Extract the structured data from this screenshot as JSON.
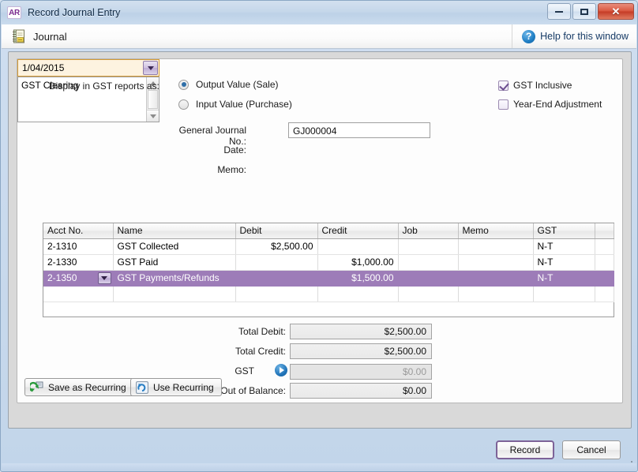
{
  "window": {
    "app_badge": "AR",
    "title": "Record Journal Entry",
    "controls": {
      "minimize": "minimize-icon",
      "maximize": "maximize-icon",
      "close": "✕"
    }
  },
  "header": {
    "icon": "journal-icon",
    "title": "Journal",
    "help_icon": "question-mark-icon",
    "help_label": "Help for this window"
  },
  "options": {
    "display_label": "Display in GST reports as:",
    "radios": [
      {
        "label": "Output Value (Sale)",
        "selected": true
      },
      {
        "label": "Input Value (Purchase)",
        "selected": false
      }
    ],
    "checkboxes": [
      {
        "label": "GST Inclusive",
        "checked": true
      },
      {
        "label": "Year-End Adjustment",
        "checked": false
      }
    ]
  },
  "form": {
    "journal_no_label": "General Journal No.:",
    "journal_no_value": "GJ000004",
    "date_label": "Date:",
    "date_value": "1/04/2015",
    "memo_label": "Memo:",
    "memo_value": "GST Clearing"
  },
  "grid": {
    "columns": [
      "Acct No.",
      "Name",
      "Debit",
      "Credit",
      "Job",
      "Memo",
      "GST"
    ],
    "rows": [
      {
        "acct": "2-1310",
        "name": "GST Collected",
        "debit": "$2,500.00",
        "credit": "",
        "job": "",
        "memo": "",
        "gst": "N-T",
        "selected": false
      },
      {
        "acct": "2-1330",
        "name": "GST Paid",
        "debit": "",
        "credit": "$1,000.00",
        "job": "",
        "memo": "",
        "gst": "N-T",
        "selected": false
      },
      {
        "acct": "2-1350",
        "name": "GST Payments/Refunds",
        "debit": "",
        "credit": "$1,500.00",
        "job": "",
        "memo": "",
        "gst": "N-T",
        "selected": true
      },
      {
        "acct": "",
        "name": "",
        "debit": "",
        "credit": "",
        "job": "",
        "memo": "",
        "gst": "",
        "selected": false
      }
    ]
  },
  "totals": {
    "total_debit_label": "Total Debit:",
    "total_debit_value": "$2,500.00",
    "total_credit_label": "Total Credit:",
    "total_credit_value": "$2,500.00",
    "gst_label": "GST",
    "gst_value": "$0.00",
    "gst_arrow_icon": "blue-arrow-right-icon",
    "out_of_balance_label": "Out of Balance:",
    "out_of_balance_value": "$0.00"
  },
  "actions": {
    "save_recurring_label": "Save as Recurring",
    "save_recurring_icon": "recurring-save-icon",
    "use_recurring_label": "Use Recurring",
    "use_recurring_icon": "recurring-refresh-icon",
    "record_label": "Record",
    "cancel_label": "Cancel"
  },
  "colors": {
    "selection_purple": "#9d7cb8",
    "focus_orange": "#d49a34",
    "accent_blue": "#2073b8",
    "default_button_border": "#7d6398"
  }
}
